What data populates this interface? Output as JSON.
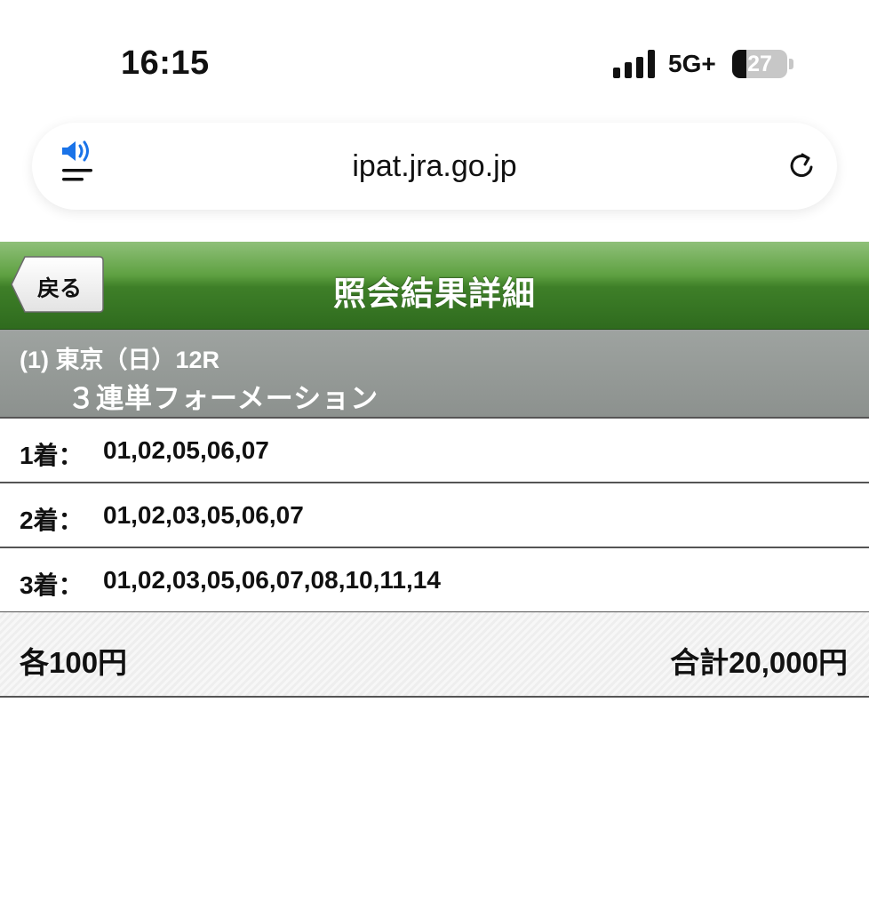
{
  "status_bar": {
    "time": "16:15",
    "network": "5G+",
    "battery": "27"
  },
  "browser": {
    "url": "ipat.jra.go.jp"
  },
  "header": {
    "back_label": "戻る",
    "title": "照会結果詳細"
  },
  "race": {
    "line1": "(1) 東京（日）12R",
    "bet_type": "３連単フォーメーション"
  },
  "selections": [
    {
      "label": "1着：",
      "values": "01,02,05,06,07"
    },
    {
      "label": "2着：",
      "values": "01,02,03,05,06,07"
    },
    {
      "label": "3着：",
      "values": "01,02,03,05,06,07,08,10,11,14"
    }
  ],
  "summary": {
    "each": "各100円",
    "total": "合計20,000円"
  },
  "colors": {
    "header_green": "#3e7f28",
    "race_gray": "#959a97",
    "accent_blue": "#1a73e8"
  }
}
